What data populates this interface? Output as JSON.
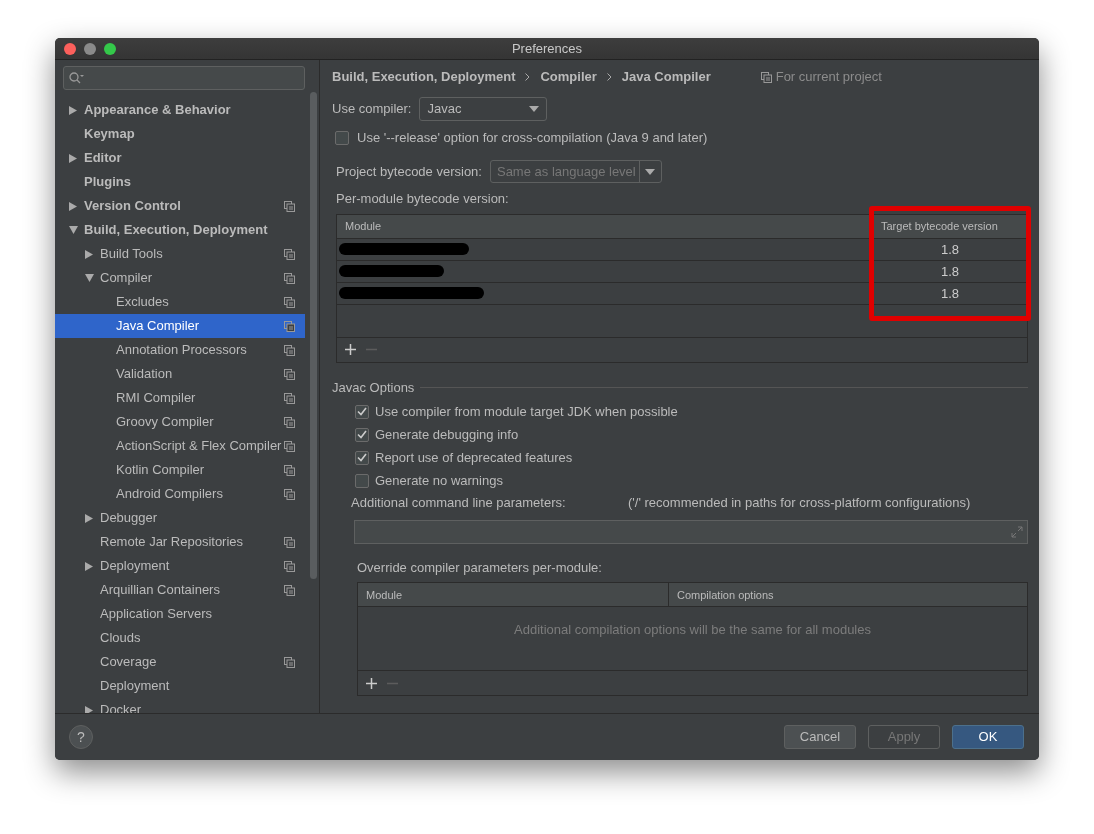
{
  "window": {
    "title": "Preferences"
  },
  "sidebar": {
    "items": [
      {
        "label": "Appearance & Behavior",
        "expanded": false,
        "project_scope": false,
        "selected": false
      },
      {
        "label": "Keymap",
        "project_scope": false,
        "selected": false
      },
      {
        "label": "Editor",
        "expanded": false,
        "project_scope": false,
        "selected": false
      },
      {
        "label": "Plugins",
        "project_scope": false,
        "selected": false
      },
      {
        "label": "Version Control",
        "expanded": false,
        "project_scope": true,
        "selected": false
      },
      {
        "label": "Build, Execution, Deployment",
        "expanded": true,
        "project_scope": false,
        "selected": false,
        "children": [
          {
            "label": "Build Tools",
            "expanded": false,
            "project_scope": true,
            "selected": false
          },
          {
            "label": "Compiler",
            "expanded": true,
            "project_scope": true,
            "selected": false,
            "children": [
              {
                "label": "Excludes",
                "project_scope": true,
                "selected": false
              },
              {
                "label": "Java Compiler",
                "project_scope": true,
                "selected": true
              },
              {
                "label": "Annotation Processors",
                "project_scope": true,
                "selected": false
              },
              {
                "label": "Validation",
                "project_scope": true,
                "selected": false
              },
              {
                "label": "RMI Compiler",
                "project_scope": true,
                "selected": false
              },
              {
                "label": "Groovy Compiler",
                "project_scope": true,
                "selected": false
              },
              {
                "label": "ActionScript & Flex Compiler",
                "project_scope": true,
                "selected": false
              },
              {
                "label": "Kotlin Compiler",
                "project_scope": true,
                "selected": false
              },
              {
                "label": "Android Compilers",
                "project_scope": true,
                "selected": false
              }
            ]
          },
          {
            "label": "Debugger",
            "expanded": false,
            "project_scope": false,
            "selected": false
          },
          {
            "label": "Remote Jar Repositories",
            "project_scope": true,
            "selected": false
          },
          {
            "label": "Deployment",
            "expanded": false,
            "project_scope": true,
            "selected": false
          },
          {
            "label": "Arquillian Containers",
            "project_scope": true,
            "selected": false
          },
          {
            "label": "Application Servers",
            "project_scope": false,
            "selected": false
          },
          {
            "label": "Clouds",
            "project_scope": false,
            "selected": false
          },
          {
            "label": "Coverage",
            "project_scope": true,
            "selected": false
          },
          {
            "label": "Deployment",
            "project_scope": false,
            "selected": false
          },
          {
            "label": "Docker",
            "expanded": false,
            "project_scope": false,
            "selected": false
          }
        ]
      }
    ]
  },
  "breadcrumb": [
    "Build, Execution, Deployment",
    "Compiler",
    "Java Compiler"
  ],
  "scope_note": "For current project",
  "use_compiler": {
    "label": "Use compiler:",
    "value": "Javac"
  },
  "release_option": {
    "label": "Use '--release' option for cross-compilation (Java 9 and later)",
    "checked": false
  },
  "project_bytecode": {
    "label": "Project bytecode version:",
    "value": "Same as language level",
    "disabled": true
  },
  "per_module": {
    "label": "Per-module bytecode version:",
    "columns": [
      {
        "label": "Module",
        "highlighted": false
      },
      {
        "label": "Target bytecode version",
        "highlighted": true
      }
    ],
    "rows": [
      {
        "module_redacted": true,
        "version": "1.8"
      },
      {
        "module_redacted": true,
        "version": "1.8"
      },
      {
        "module_redacted": true,
        "version": "1.8"
      }
    ]
  },
  "javac_options": {
    "title": "Javac Options",
    "options": [
      {
        "label": "Use compiler from module target JDK when possible",
        "checked": true
      },
      {
        "label": "Generate debugging info",
        "checked": true
      },
      {
        "label": "Report use of deprecated features",
        "checked": true
      },
      {
        "label": "Generate no warnings",
        "checked": false
      }
    ],
    "params_label": "Additional command line parameters:",
    "params_hint": "('/' recommended in paths for cross-platform configurations)",
    "override": {
      "label": "Override compiler parameters per-module:",
      "columns": [
        "Module",
        "Compilation options"
      ],
      "empty_text": "Additional compilation options will be the same for all modules"
    }
  },
  "help": "?",
  "buttons": [
    {
      "label": "Cancel",
      "kind": "normal"
    },
    {
      "label": "Apply",
      "kind": "disabled"
    },
    {
      "label": "OK",
      "kind": "default"
    }
  ]
}
